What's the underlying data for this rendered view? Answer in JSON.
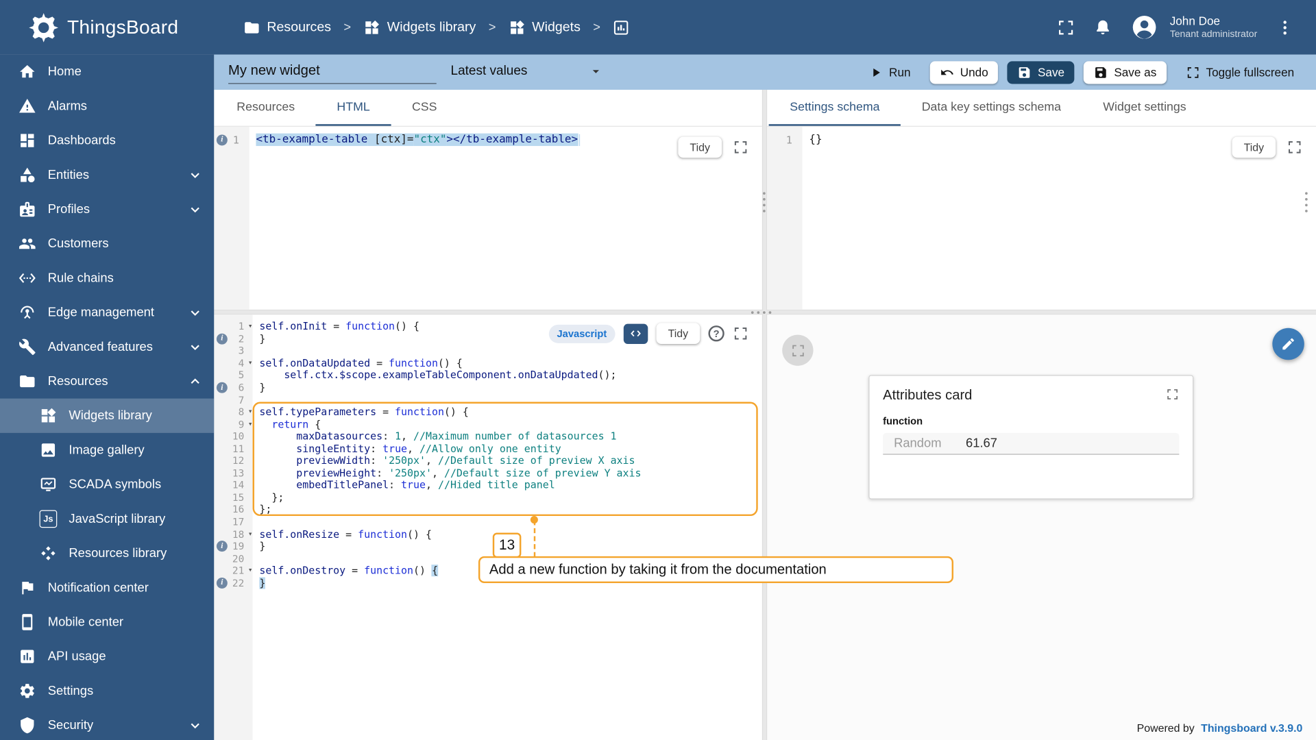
{
  "header": {
    "app_name": "ThingsBoard",
    "breadcrumb": [
      {
        "icon": "folder",
        "label": "Resources"
      },
      {
        "icon": "widgets",
        "label": "Widgets library"
      },
      {
        "icon": "widgets",
        "label": "Widgets"
      },
      {
        "icon": "chart",
        "label": ""
      }
    ],
    "user_name": "John Doe",
    "user_role": "Tenant administrator"
  },
  "toolbar": {
    "title_value": "My new widget",
    "type_value": "Latest values",
    "run": "Run",
    "undo": "Undo",
    "save": "Save",
    "save_as": "Save as",
    "toggle_fullscreen": "Toggle fullscreen"
  },
  "sidebar": {
    "items": [
      {
        "icon": "home",
        "label": "Home"
      },
      {
        "icon": "warning",
        "label": "Alarms"
      },
      {
        "icon": "dashboard",
        "label": "Dashboards"
      },
      {
        "icon": "category",
        "label": "Entities",
        "chevron": "down"
      },
      {
        "icon": "badge",
        "label": "Profiles",
        "chevron": "down"
      },
      {
        "icon": "people",
        "label": "Customers"
      },
      {
        "icon": "ethernet",
        "label": "Rule chains"
      },
      {
        "icon": "antenna",
        "label": "Edge management",
        "chevron": "down"
      },
      {
        "icon": "tools",
        "label": "Advanced features",
        "chevron": "down"
      },
      {
        "icon": "folder",
        "label": "Resources",
        "chevron": "up"
      },
      {
        "icon": "widgets",
        "label": "Widgets library",
        "sub": true,
        "selected": true
      },
      {
        "icon": "image",
        "label": "Image gallery",
        "sub": true
      },
      {
        "icon": "scada",
        "label": "SCADA symbols",
        "sub": true
      },
      {
        "icon": "js",
        "label": "JavaScript library",
        "sub": true
      },
      {
        "icon": "diamonds",
        "label": "Resources library",
        "sub": true
      },
      {
        "icon": "flag",
        "label": "Notification center"
      },
      {
        "icon": "phone",
        "label": "Mobile center"
      },
      {
        "icon": "chartbox",
        "label": "API usage"
      },
      {
        "icon": "gear",
        "label": "Settings"
      },
      {
        "icon": "shield",
        "label": "Security",
        "chevron": "down"
      }
    ]
  },
  "html_panel": {
    "tabs": [
      "Resources",
      "HTML",
      "CSS"
    ],
    "active_tab": "HTML",
    "tidy": "Tidy",
    "lines": [
      {
        "n": "1",
        "info": true,
        "sel": true,
        "cursor": true,
        "tokens": [
          [
            "t",
            "<tb-example-table"
          ],
          [
            "p",
            " [ctx]="
          ],
          [
            "s",
            "\"ctx\""
          ],
          [
            "t",
            "></tb-example-table>"
          ]
        ]
      }
    ]
  },
  "schema_panel": {
    "tabs": [
      "Settings schema",
      "Data key settings schema",
      "Widget settings"
    ],
    "active_tab": "Settings schema",
    "tidy": "Tidy",
    "lines": [
      {
        "n": "1",
        "tokens": [
          [
            "p",
            "{}"
          ]
        ]
      }
    ]
  },
  "js_panel": {
    "language": "Javascript",
    "tidy": "Tidy",
    "lines": [
      {
        "n": "1",
        "fold": true,
        "tokens": [
          [
            "i",
            "self.onInit"
          ],
          [
            "p",
            " = "
          ],
          [
            "k",
            "function"
          ],
          [
            "p",
            "() {"
          ]
        ]
      },
      {
        "n": "2",
        "info": true,
        "tokens": [
          [
            "p",
            "}"
          ]
        ]
      },
      {
        "n": "3",
        "tokens": []
      },
      {
        "n": "4",
        "fold": true,
        "tokens": [
          [
            "i",
            "self.onDataUpdated"
          ],
          [
            "p",
            " = "
          ],
          [
            "k",
            "function"
          ],
          [
            "p",
            "() {"
          ]
        ]
      },
      {
        "n": "5",
        "tokens": [
          [
            "p",
            "    "
          ],
          [
            "i",
            "self.ctx.$scope.exampleTableComponent.onDataUpdated"
          ],
          [
            "p",
            "();"
          ]
        ]
      },
      {
        "n": "6",
        "info": true,
        "tokens": [
          [
            "p",
            "}"
          ]
        ]
      },
      {
        "n": "7",
        "tokens": []
      },
      {
        "n": "8",
        "fold": true,
        "tokens": [
          [
            "i",
            "self.typeParameters"
          ],
          [
            "p",
            " = "
          ],
          [
            "k",
            "function"
          ],
          [
            "p",
            "() {"
          ]
        ]
      },
      {
        "n": "9",
        "fold": true,
        "tokens": [
          [
            "p",
            "  "
          ],
          [
            "k",
            "return"
          ],
          [
            "p",
            " {"
          ]
        ]
      },
      {
        "n": "10",
        "tokens": [
          [
            "p",
            "      "
          ],
          [
            "i",
            "maxDatasources"
          ],
          [
            "p",
            ": "
          ],
          [
            "n",
            "1"
          ],
          [
            "p",
            ", "
          ],
          [
            "c",
            "//Maximum number of datasources 1"
          ]
        ]
      },
      {
        "n": "11",
        "tokens": [
          [
            "p",
            "      "
          ],
          [
            "i",
            "singleEntity"
          ],
          [
            "p",
            ": "
          ],
          [
            "k",
            "true"
          ],
          [
            "p",
            ", "
          ],
          [
            "c",
            "//Allow only one entity"
          ]
        ]
      },
      {
        "n": "12",
        "tokens": [
          [
            "p",
            "      "
          ],
          [
            "i",
            "previewWidth"
          ],
          [
            "p",
            ": "
          ],
          [
            "s",
            "'250px'"
          ],
          [
            "p",
            ", "
          ],
          [
            "c",
            "//Default size of preview X axis"
          ]
        ]
      },
      {
        "n": "13",
        "tokens": [
          [
            "p",
            "      "
          ],
          [
            "i",
            "previewHeight"
          ],
          [
            "p",
            ": "
          ],
          [
            "s",
            "'250px'"
          ],
          [
            "p",
            ", "
          ],
          [
            "c",
            "//Default size of preview Y axis"
          ]
        ]
      },
      {
        "n": "14",
        "tokens": [
          [
            "p",
            "      "
          ],
          [
            "i",
            "embedTitlePanel"
          ],
          [
            "p",
            ": "
          ],
          [
            "k",
            "true"
          ],
          [
            "p",
            ", "
          ],
          [
            "c",
            "//Hided title panel"
          ]
        ]
      },
      {
        "n": "15",
        "tokens": [
          [
            "p",
            "  };"
          ]
        ]
      },
      {
        "n": "16",
        "tokens": [
          [
            "p",
            "};"
          ]
        ]
      },
      {
        "n": "17",
        "tokens": []
      },
      {
        "n": "18",
        "fold": true,
        "tokens": [
          [
            "i",
            "self.onResize"
          ],
          [
            "p",
            " = "
          ],
          [
            "k",
            "function"
          ],
          [
            "p",
            "() {"
          ]
        ]
      },
      {
        "n": "19",
        "info": true,
        "tokens": [
          [
            "p",
            "}"
          ]
        ]
      },
      {
        "n": "20",
        "tokens": []
      },
      {
        "n": "21",
        "fold": true,
        "tokens": [
          [
            "i",
            "self.onDestroy"
          ],
          [
            "p",
            " = "
          ],
          [
            "k",
            "function"
          ],
          [
            "p",
            "() "
          ],
          [
            "m",
            "{"
          ]
        ]
      },
      {
        "n": "22",
        "info": true,
        "tokens": [
          [
            "m",
            "}"
          ]
        ]
      }
    ]
  },
  "annotation": {
    "step": "13",
    "text": "Add a new function by taking it from the documentation"
  },
  "preview": {
    "card_title": "Attributes card",
    "group_label": "function",
    "row_key": "Random",
    "row_value": "61.67",
    "footer_text": "Powered by",
    "footer_link": "Thingsboard v.3.9.0"
  }
}
